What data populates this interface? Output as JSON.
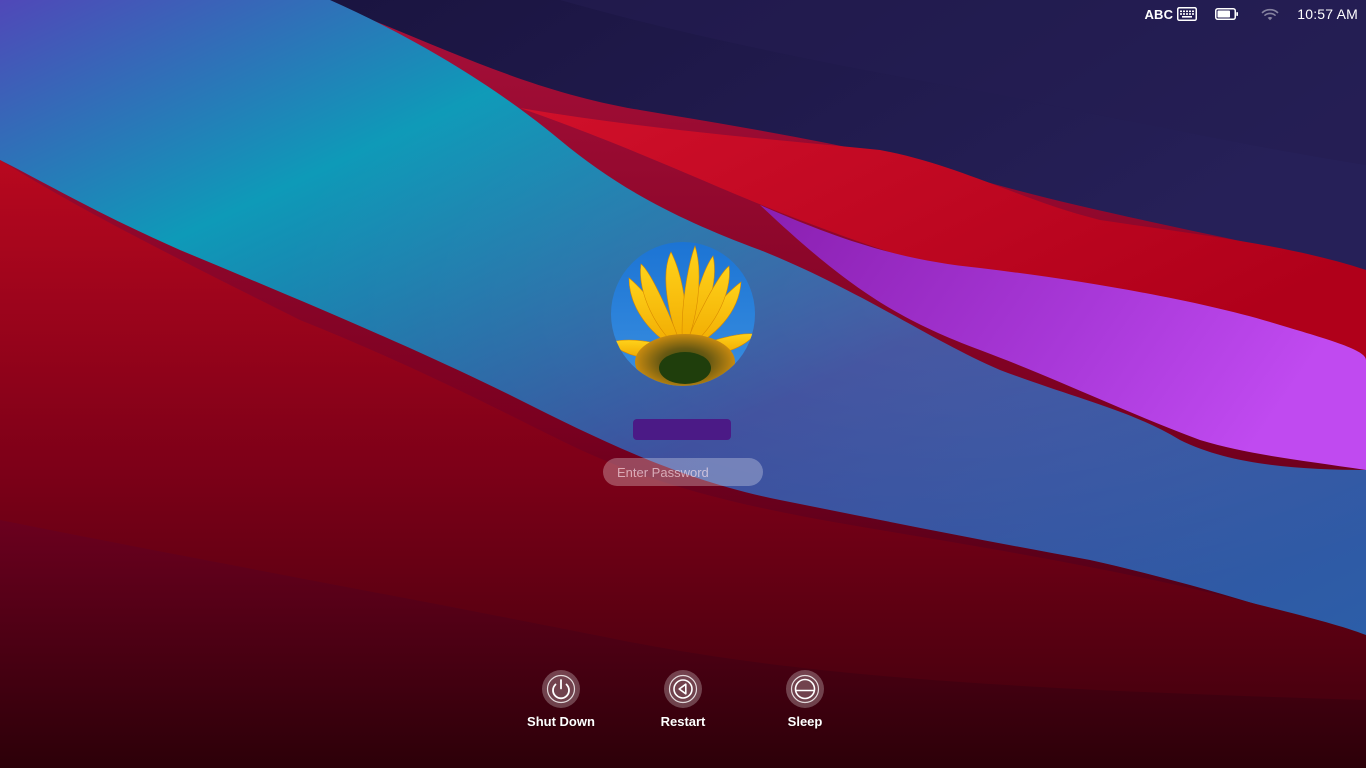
{
  "menubar": {
    "input_source": "ABC",
    "keyboard_icon": "keyboard-icon",
    "battery_icon": "battery-icon",
    "wifi_icon": "wifi-icon",
    "clock": "10:57 AM"
  },
  "user": {
    "avatar": "sunflower-avatar",
    "name": ""
  },
  "password": {
    "placeholder": "Enter Password",
    "value": ""
  },
  "power": {
    "shut_down_label": "Shut Down",
    "shut_down_icon": "power-icon",
    "restart_label": "Restart",
    "restart_icon": "restart-icon",
    "sleep_label": "Sleep",
    "sleep_icon": "sleep-icon"
  },
  "colors": {
    "wallpaper_top": "#1c1640",
    "wallpaper_teal": "#0d8db3",
    "wallpaper_red": "#c0061f",
    "wallpaper_purple": "#b23ee8",
    "username_bar": "#4b1a86"
  }
}
